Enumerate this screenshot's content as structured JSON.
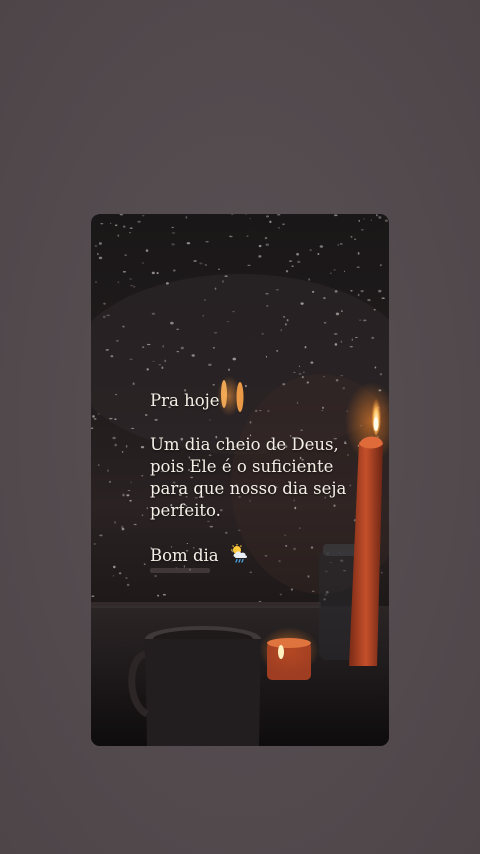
{
  "story": {
    "heading": "Pra hoje",
    "message_lines": [
      "Um dia cheio de Deus,",
      "pois Ele é o suficiente",
      "para que nosso dia seja",
      "perfeito."
    ],
    "closing": "Bom dia",
    "closing_icon": "sun-behind-rain-cloud-icon"
  },
  "colors": {
    "background": "#544c4f",
    "text": "#f4efe6",
    "candle_flame": "#ffb347"
  }
}
